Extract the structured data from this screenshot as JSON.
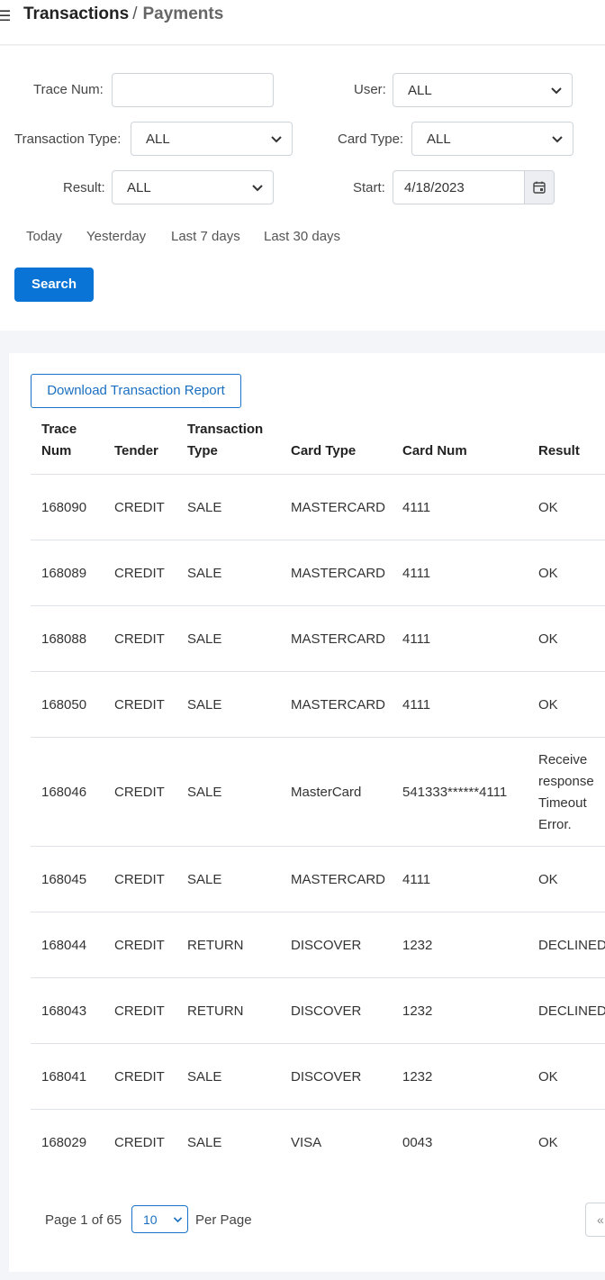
{
  "breadcrumb": {
    "parent": "Transactions",
    "separator": "/",
    "current": "Payments"
  },
  "filters": {
    "trace_num": {
      "label": "Trace Num:",
      "value": ""
    },
    "user": {
      "label": "User:",
      "value": "ALL"
    },
    "transaction_type": {
      "label": "Transaction Type:",
      "value": "ALL"
    },
    "card_type": {
      "label": "Card Type:",
      "value": "ALL"
    },
    "result": {
      "label": "Result:",
      "value": "ALL"
    },
    "start": {
      "label": "Start:",
      "value": "4/18/2023"
    },
    "quick_ranges": [
      "Today",
      "Yesterday",
      "Last 7 days",
      "Last 30 days"
    ],
    "search_label": "Search"
  },
  "report": {
    "download_label": "Download Transaction Report",
    "headers": {
      "trace_num": [
        "Trace",
        "Num"
      ],
      "tender": "Tender",
      "transaction_type": [
        "Transaction",
        "Type"
      ],
      "card_type": "Card Type",
      "card_num": "Card Num",
      "result": "Result"
    },
    "rows": [
      {
        "trace": "168090",
        "tender": "CREDIT",
        "type": "SALE",
        "card_type": "MASTERCARD",
        "card_num": "4111",
        "result": [
          "OK"
        ]
      },
      {
        "trace": "168089",
        "tender": "CREDIT",
        "type": "SALE",
        "card_type": "MASTERCARD",
        "card_num": "4111",
        "result": [
          "OK"
        ]
      },
      {
        "trace": "168088",
        "tender": "CREDIT",
        "type": "SALE",
        "card_type": "MASTERCARD",
        "card_num": "4111",
        "result": [
          "OK"
        ]
      },
      {
        "trace": "168050",
        "tender": "CREDIT",
        "type": "SALE",
        "card_type": "MASTERCARD",
        "card_num": "4111",
        "result": [
          "OK"
        ]
      },
      {
        "trace": "168046",
        "tender": "CREDIT",
        "type": "SALE",
        "card_type": "MasterCard",
        "card_num": "541333******4111",
        "result": [
          "Receive",
          "response",
          "Timeout",
          "Error."
        ]
      },
      {
        "trace": "168045",
        "tender": "CREDIT",
        "type": "SALE",
        "card_type": "MASTERCARD",
        "card_num": "4111",
        "result": [
          "OK"
        ]
      },
      {
        "trace": "168044",
        "tender": "CREDIT",
        "type": "RETURN",
        "card_type": "DISCOVER",
        "card_num": "1232",
        "result": [
          "DECLINED"
        ]
      },
      {
        "trace": "168043",
        "tender": "CREDIT",
        "type": "RETURN",
        "card_type": "DISCOVER",
        "card_num": "1232",
        "result": [
          "DECLINED"
        ]
      },
      {
        "trace": "168041",
        "tender": "CREDIT",
        "type": "SALE",
        "card_type": "DISCOVER",
        "card_num": "1232",
        "result": [
          "OK"
        ]
      },
      {
        "trace": "168029",
        "tender": "CREDIT",
        "type": "SALE",
        "card_type": "VISA",
        "card_num": "0043",
        "result": [
          "OK"
        ]
      }
    ]
  },
  "pagination": {
    "page_text": "Page 1 of 65",
    "per_page_value": "10",
    "per_page_label": "Per Page",
    "first_label": "«"
  }
}
